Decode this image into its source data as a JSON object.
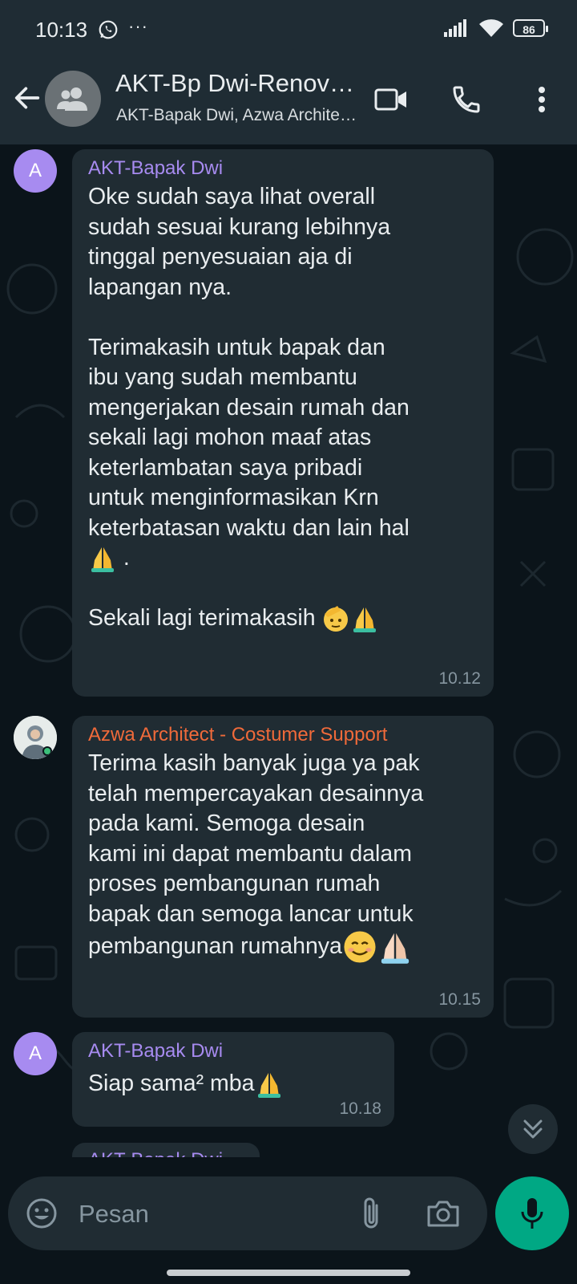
{
  "status_bar": {
    "time": "10:13",
    "more": "···",
    "battery": "86"
  },
  "header": {
    "title": "AKT-Bp Dwi-Renovasi Rumah",
    "subtitle": "AKT-Bapak Dwi, Azwa Architect - Costumer Support"
  },
  "messages": [
    {
      "sender": "AKT-Bapak Dwi",
      "avatar_letter": "A",
      "sender_color": "#a78bf0",
      "text_main": "Oke sudah saya lihat overall\nsudah sesuai kurang lebihnya\ntinggal penyesuaian aja di\nlapangan nya.\n\nTerimakasih untuk bapak dan\nibu yang sudah membantu\nmengerjakan desain rumah dan\nsekali lagi mohon maaf atas\nketerlambatan saya pribadi\nuntuk menginformasikan Krn\nketerbatasan waktu dan lain hal",
      "text_line2": " .",
      "text_last": "Sekali lagi terimakasih ",
      "time": "10.12"
    },
    {
      "sender": "Azwa Architect - Costumer Support",
      "sender_color": "#f06a3a",
      "text_main": "Terima kasih banyak juga ya pak\ntelah mempercayakan desainnya\npada kami. Semoga desain\nkami ini dapat membantu dalam\nproses pembangunan rumah\nbapak dan semoga lancar untuk",
      "text_last": "pembangunan rumahnya",
      "time": "10.15"
    },
    {
      "sender": "AKT-Bapak Dwi",
      "avatar_letter": "A",
      "sender_color": "#a78bf0",
      "text": "Siap sama² mba",
      "time": "10.18"
    },
    {
      "sender": "AKT-Bapak Dwi",
      "sender_color": "#a78bf0"
    }
  ],
  "input": {
    "placeholder": "Pesan"
  },
  "colors": {
    "accent": "#00a884",
    "bubble": "#202c33",
    "background": "#0b141a"
  },
  "icons": [
    "whatsapp-icon",
    "signal-icon",
    "wifi-icon",
    "back-arrow-icon",
    "group-icon",
    "video-call-icon",
    "voice-call-icon",
    "more-vert-icon",
    "emoji-icon",
    "attach-icon",
    "camera-icon",
    "mic-icon",
    "chevron-double-down-icon",
    "folded-hands-emoji",
    "saluting-face-emoji",
    "smiling-face-emoji"
  ]
}
